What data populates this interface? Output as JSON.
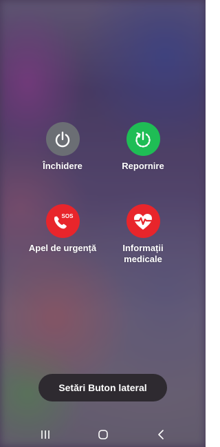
{
  "power_menu": {
    "items": [
      {
        "label": "Închidere",
        "icon": "power-icon",
        "color": "#6b6e74"
      },
      {
        "label": "Repornire",
        "icon": "restart-icon",
        "color": "#1fbd55"
      },
      {
        "label": "Apel de urgență",
        "icon": "sos-phone-icon",
        "color": "#e8252b",
        "icon_text": "SOS"
      },
      {
        "label": "Informații\nmedicale",
        "icon": "medical-heart-icon",
        "color": "#e8252b"
      }
    ]
  },
  "side_button_settings": {
    "label": "Setări Buton lateral"
  },
  "nav_bar": {
    "items": [
      "recents-icon",
      "home-icon",
      "back-icon"
    ]
  }
}
